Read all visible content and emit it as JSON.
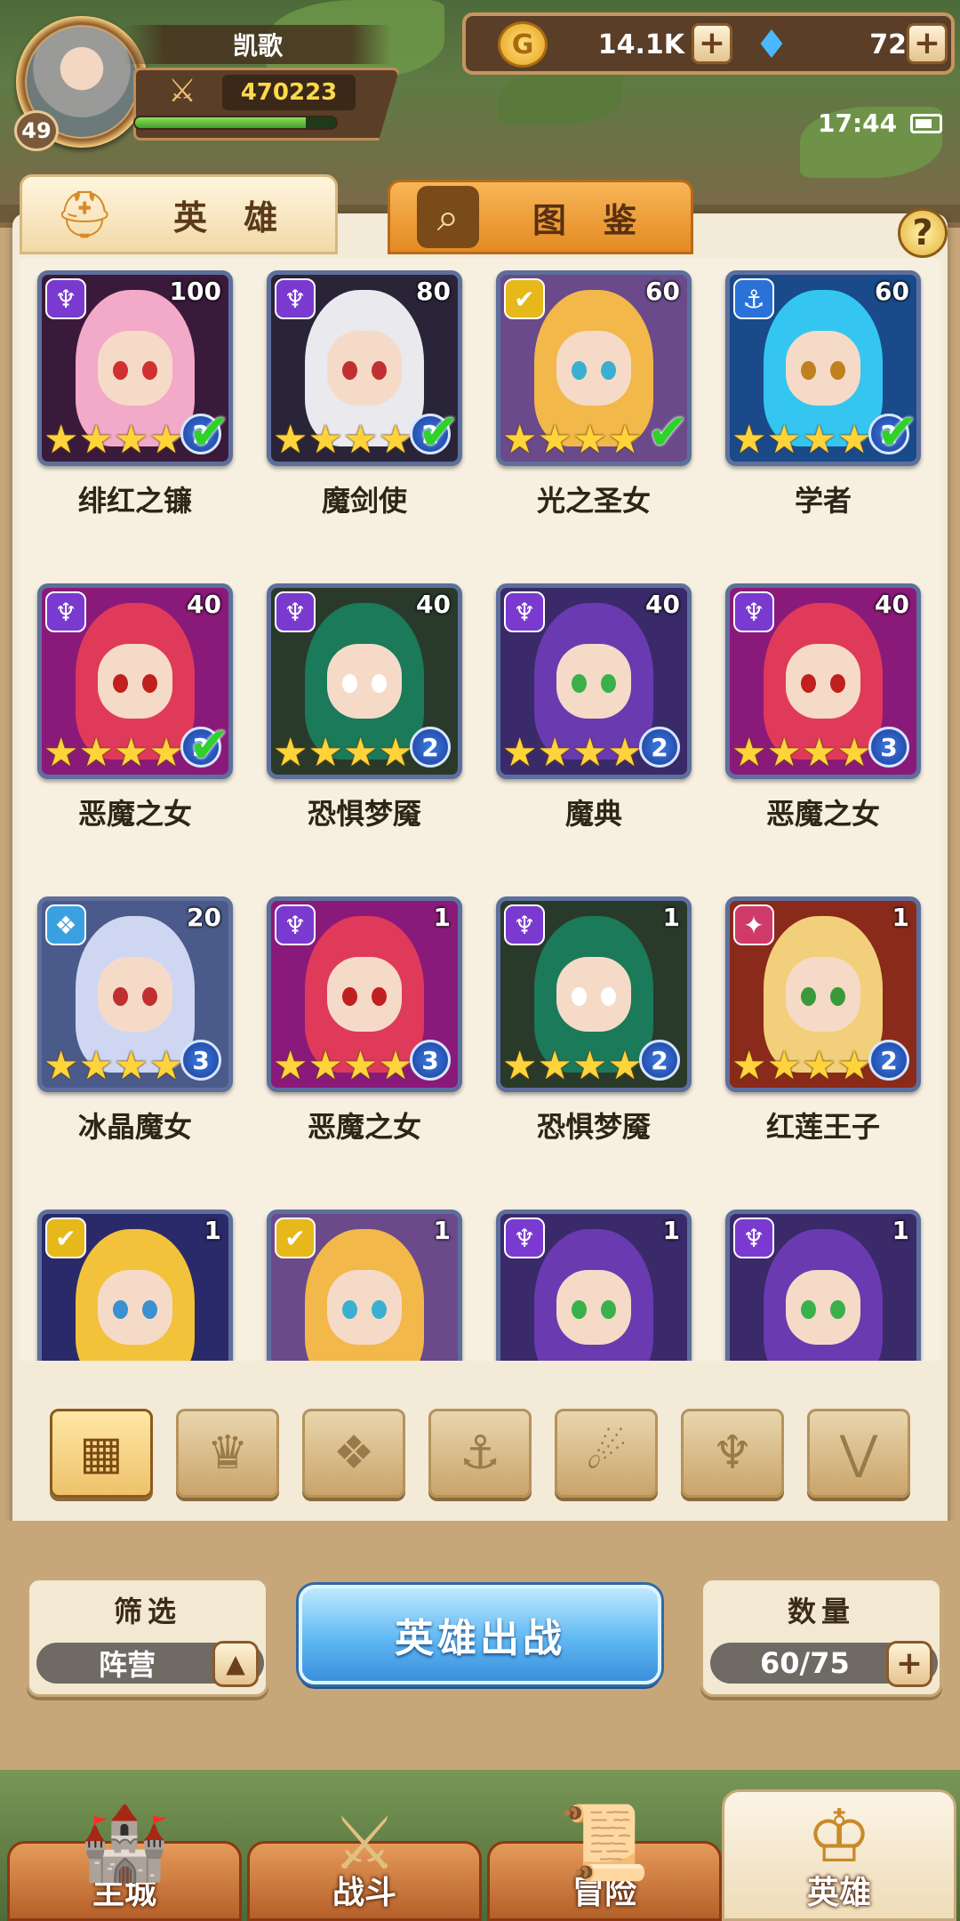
{
  "player": {
    "name": "凯歌",
    "level": "49",
    "power": "470223",
    "xp_fraction": 0.85
  },
  "resources": {
    "gold": "14.1K",
    "gems": "72",
    "gold_glyph": "G",
    "gem_glyph": "♦",
    "plus": "+"
  },
  "status": {
    "time": "17:44"
  },
  "tabs": {
    "heroes": "英 雄",
    "codex": "图 鉴"
  },
  "help": "?",
  "faction_glyphs": {
    "dark": "♆",
    "light": "✔",
    "water": "⚓",
    "ice": "❖",
    "fire": "✦",
    "beast": "⚡",
    "all": "▦",
    "wind": "⋀"
  },
  "heroes": [
    {
      "name": "绯红之镰",
      "level": "100",
      "faction": "dark",
      "stars": 4,
      "rank": "2",
      "owned": true,
      "hair": "#f3a9c8",
      "bg": "#3a1a3a",
      "eye": "#d03030"
    },
    {
      "name": "魔剑使",
      "level": "80",
      "faction": "dark",
      "stars": 4,
      "rank": "2",
      "owned": true,
      "hair": "#e9e9ee",
      "bg": "#2a2438",
      "eye": "#c03030"
    },
    {
      "name": "光之圣女",
      "level": "60",
      "faction": "light",
      "stars": 4,
      "rank": "",
      "owned": true,
      "hair": "#f2b84a",
      "bg": "#6a4a8a",
      "eye": "#3ab0d0"
    },
    {
      "name": "学者",
      "level": "60",
      "faction": "water",
      "stars": 4,
      "rank": "2",
      "owned": true,
      "hair": "#34c6f0",
      "bg": "#1a4a8a",
      "eye": "#c08020"
    },
    {
      "name": "恶魔之女",
      "level": "40",
      "faction": "dark",
      "stars": 4,
      "rank": "3",
      "owned": true,
      "hair": "#e03a5a",
      "bg": "#8a1a7a",
      "eye": "#c02020"
    },
    {
      "name": "恐惧梦魇",
      "level": "40",
      "faction": "dark",
      "stars": 4,
      "rank": "2",
      "owned": false,
      "hair": "#1a7a5a",
      "bg": "#2a3a2a",
      "eye": "#ffffff"
    },
    {
      "name": "魔典",
      "level": "40",
      "faction": "dark",
      "stars": 4,
      "rank": "2",
      "owned": false,
      "hair": "#6a3ab0",
      "bg": "#3a2a6a",
      "eye": "#3ab04a"
    },
    {
      "name": "恶魔之女",
      "level": "40",
      "faction": "dark",
      "stars": 4,
      "rank": "3",
      "owned": false,
      "hair": "#e03a5a",
      "bg": "#8a1a7a",
      "eye": "#c02020"
    },
    {
      "name": "冰晶魔女",
      "level": "20",
      "faction": "ice",
      "stars": 4,
      "rank": "3",
      "owned": false,
      "hair": "#cfd6f2",
      "bg": "#4a5a8a",
      "eye": "#c03030"
    },
    {
      "name": "恶魔之女",
      "level": "1",
      "faction": "dark",
      "stars": 4,
      "rank": "3",
      "owned": false,
      "hair": "#e03a5a",
      "bg": "#8a1a7a",
      "eye": "#c02020"
    },
    {
      "name": "恐惧梦魇",
      "level": "1",
      "faction": "dark",
      "stars": 4,
      "rank": "2",
      "owned": false,
      "hair": "#1a7a5a",
      "bg": "#2a3a2a",
      "eye": "#ffffff"
    },
    {
      "name": "红莲王子",
      "level": "1",
      "faction": "fire",
      "stars": 4,
      "rank": "2",
      "owned": false,
      "hair": "#f2cf7a",
      "bg": "#8a2a1a",
      "eye": "#3a9a3a"
    },
    {
      "name": "",
      "level": "1",
      "faction": "light",
      "stars": 0,
      "rank": "",
      "owned": false,
      "hair": "#f2c23a",
      "bg": "#2a2a6a",
      "eye": "#3a90d0"
    },
    {
      "name": "",
      "level": "1",
      "faction": "light",
      "stars": 0,
      "rank": "",
      "owned": false,
      "hair": "#f2b84a",
      "bg": "#6a4a8a",
      "eye": "#3ab0d0"
    },
    {
      "name": "",
      "level": "1",
      "faction": "dark",
      "stars": 0,
      "rank": "",
      "owned": false,
      "hair": "#6a3ab0",
      "bg": "#3a2a6a",
      "eye": "#3ab04a"
    },
    {
      "name": "",
      "level": "1",
      "faction": "dark",
      "stars": 0,
      "rank": "",
      "owned": false,
      "hair": "#6a3ab0",
      "bg": "#3a2a6a",
      "eye": "#3ab04a"
    }
  ],
  "faction_colors": {
    "dark": "#7a3ad0",
    "light": "#e6b81a",
    "water": "#2a72d8",
    "ice": "#3aa0e0",
    "fire": "#d03a6a"
  },
  "filters": [
    {
      "icon": "grid-icon",
      "glyph": "▦",
      "active": true
    },
    {
      "icon": "fire-faction-icon",
      "glyph": "♛",
      "active": false
    },
    {
      "icon": "ice-faction-icon",
      "glyph": "❖",
      "active": false
    },
    {
      "icon": "anchor-faction-icon",
      "glyph": "⚓",
      "active": false
    },
    {
      "icon": "beast-faction-icon",
      "glyph": "☄",
      "active": false
    },
    {
      "icon": "dark-faction-icon",
      "glyph": "♆",
      "active": false
    },
    {
      "icon": "light-faction-icon",
      "glyph": "⋁",
      "active": false
    }
  ],
  "controls": {
    "filter_title": "筛选",
    "filter_value": "阵营",
    "filter_arrow": "▲",
    "deploy_label": "英雄出战",
    "count_title": "数量",
    "count_value": "60/75",
    "count_plus": "+"
  },
  "nav": [
    {
      "label": "主城",
      "icon": "city-icon",
      "glyph": "🏰",
      "active": false
    },
    {
      "label": "战斗",
      "icon": "battle-icon",
      "glyph": "⚔",
      "active": false
    },
    {
      "label": "冒险",
      "icon": "adventure-icon",
      "glyph": "📜",
      "active": false
    },
    {
      "label": "英雄",
      "icon": "hero-icon",
      "glyph": "♔",
      "active": true
    }
  ]
}
